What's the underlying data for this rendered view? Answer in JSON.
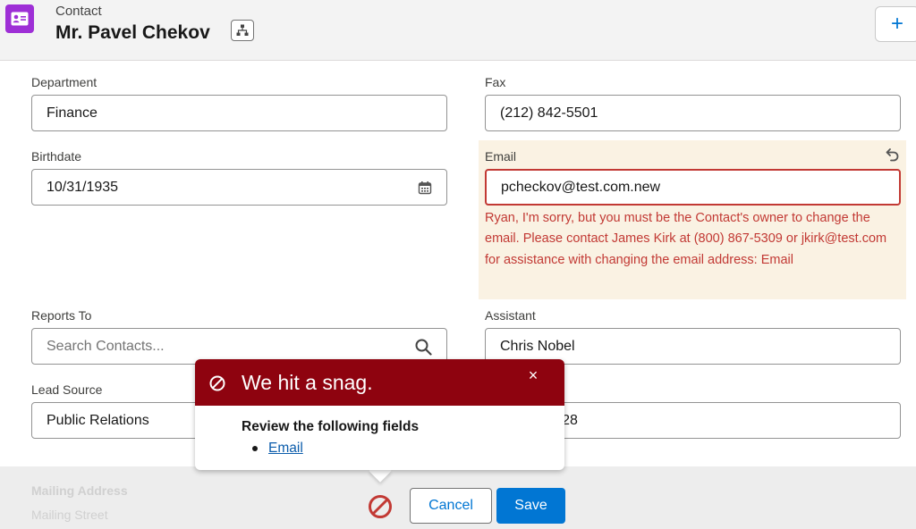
{
  "header": {
    "object_type": "Contact",
    "record_name": "Mr. Pavel Chekov",
    "icons": {
      "object": "contact-card-icon",
      "hierarchy": "hierarchy-icon",
      "add": "plus-icon"
    },
    "add_label": "+"
  },
  "form": {
    "department": {
      "label": "Department",
      "value": "Finance"
    },
    "fax": {
      "label": "Fax",
      "value": "(212) 842-5501"
    },
    "birthdate": {
      "label": "Birthdate",
      "value": "10/31/1935"
    },
    "email": {
      "label": "Email",
      "value": "pcheckov@test.com.new",
      "error": "Ryan, I'm sorry, but you must be the Contact's owner to change the email. Please contact James Kirk at (800) 867-5309 or jkirk@test.com for assistance with changing the email address: Email"
    },
    "reports_to": {
      "label": "Reports To",
      "placeholder": "Search Contacts..."
    },
    "assistant": {
      "label": "Assistant",
      "value": "Chris Nobel"
    },
    "lead_source": {
      "label": "Lead Source",
      "value": "Public Relations"
    },
    "asst_phone": {
      "value": "-5428"
    }
  },
  "bottom": {
    "mailing_address": "Mailing Address",
    "mailing_street": "Mailing Street",
    "other_address_partial": "ess"
  },
  "popover": {
    "title": "We hit a snag.",
    "close": "×",
    "body_title": "Review the following fields",
    "fields": [
      "Email"
    ]
  },
  "footer": {
    "cancel_label": "Cancel",
    "save_label": "Save"
  },
  "colors": {
    "accent": "#0176d3",
    "error": "#c23934",
    "popover_header": "#8e030f",
    "warning_bg": "#faf2e3",
    "object_icon": "#9e2fd6"
  }
}
